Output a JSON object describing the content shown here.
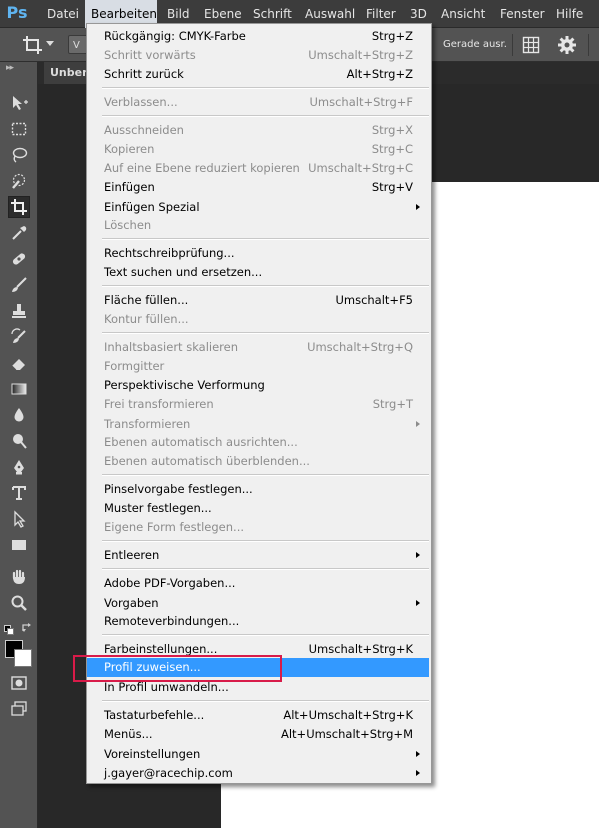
{
  "app": {
    "logo": "Ps"
  },
  "menubar": {
    "items": [
      "Datei",
      "Bearbeiten",
      "Bild",
      "Ebene",
      "Schrift",
      "Auswahl",
      "Filter",
      "3D",
      "Ansicht",
      "Fenster",
      "Hilfe"
    ],
    "active": "Bearbeiten"
  },
  "options_bar": {
    "ratio_value": "V",
    "straighten_label": "Gerade ausr."
  },
  "document": {
    "tab_title": "Unben"
  },
  "edit_menu": {
    "items": [
      {
        "label": "Rückgängig: CMYK-Farbe",
        "shortcut": "Strg+Z",
        "enabled": true
      },
      {
        "label": "Schritt vorwärts",
        "shortcut": "Umschalt+Strg+Z",
        "enabled": false
      },
      {
        "label": "Schritt zurück",
        "shortcut": "Alt+Strg+Z",
        "enabled": true
      },
      {
        "label": "Verblassen...",
        "shortcut": "Umschalt+Strg+F",
        "enabled": false
      },
      {
        "label": "Ausschneiden",
        "shortcut": "Strg+X",
        "enabled": false
      },
      {
        "label": "Kopieren",
        "shortcut": "Strg+C",
        "enabled": false
      },
      {
        "label": "Auf eine Ebene reduziert kopieren",
        "shortcut": "Umschalt+Strg+C",
        "enabled": false
      },
      {
        "label": "Einfügen",
        "shortcut": "Strg+V",
        "enabled": true
      },
      {
        "label": "Einfügen Spezial",
        "shortcut": "",
        "enabled": true,
        "submenu": true
      },
      {
        "label": "Löschen",
        "shortcut": "",
        "enabled": false
      },
      {
        "label": "Rechtschreibprüfung...",
        "shortcut": "",
        "enabled": true
      },
      {
        "label": "Text suchen und ersetzen...",
        "shortcut": "",
        "enabled": true
      },
      {
        "label": "Fläche füllen...",
        "shortcut": "Umschalt+F5",
        "enabled": true
      },
      {
        "label": "Kontur füllen...",
        "shortcut": "",
        "enabled": false
      },
      {
        "label": "Inhaltsbasiert skalieren",
        "shortcut": "Umschalt+Strg+Q",
        "enabled": false
      },
      {
        "label": "Formgitter",
        "shortcut": "",
        "enabled": false
      },
      {
        "label": "Perspektivische Verformung",
        "shortcut": "",
        "enabled": true
      },
      {
        "label": "Frei transformieren",
        "shortcut": "Strg+T",
        "enabled": false
      },
      {
        "label": "Transformieren",
        "shortcut": "",
        "enabled": false,
        "submenu": true
      },
      {
        "label": "Ebenen automatisch ausrichten...",
        "shortcut": "",
        "enabled": false
      },
      {
        "label": "Ebenen automatisch überblenden...",
        "shortcut": "",
        "enabled": false
      },
      {
        "label": "Pinselvorgabe festlegen...",
        "shortcut": "",
        "enabled": true
      },
      {
        "label": "Muster festlegen...",
        "shortcut": "",
        "enabled": true
      },
      {
        "label": "Eigene Form festlegen...",
        "shortcut": "",
        "enabled": false
      },
      {
        "label": "Entleeren",
        "shortcut": "",
        "enabled": true,
        "submenu": true
      },
      {
        "label": "Adobe PDF-Vorgaben...",
        "shortcut": "",
        "enabled": true
      },
      {
        "label": "Vorgaben",
        "shortcut": "",
        "enabled": true,
        "submenu": true
      },
      {
        "label": "Remoteverbindungen...",
        "shortcut": "",
        "enabled": true
      },
      {
        "label": "Farbeinstellungen...",
        "shortcut": "Umschalt+Strg+K",
        "enabled": true
      },
      {
        "label": "Profil zuweisen...",
        "shortcut": "",
        "enabled": true,
        "highlighted": true
      },
      {
        "label": "In Profil umwandeln...",
        "shortcut": "",
        "enabled": true
      },
      {
        "label": "Tastaturbefehle...",
        "shortcut": "Alt+Umschalt+Strg+K",
        "enabled": true
      },
      {
        "label": "Menüs...",
        "shortcut": "Alt+Umschalt+Strg+M",
        "enabled": true
      },
      {
        "label": "Voreinstellungen",
        "shortcut": "",
        "enabled": true,
        "submenu": true
      },
      {
        "label": "j.gayer@racechip.com",
        "shortcut": "",
        "enabled": true,
        "submenu": true
      }
    ]
  },
  "colors": {
    "menu_highlight": "#3399ff",
    "annotation": "#d81b49",
    "ps_logo": "#5fb4f0"
  }
}
